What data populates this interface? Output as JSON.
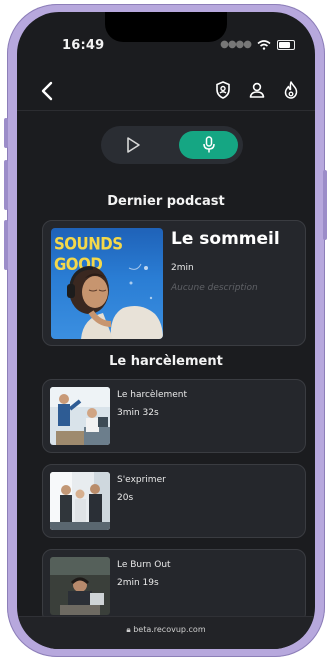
{
  "status": {
    "time": "16:49"
  },
  "sections": {
    "latest_title": "Dernier podcast",
    "category_title": "Le harcèlement"
  },
  "featured": {
    "cover_text": "SOUNDS GOOD",
    "title": "Le sommeil",
    "duration": "2min",
    "description": "Aucune description"
  },
  "episodes": [
    {
      "title": "Le harcèlement",
      "duration": "3min 32s"
    },
    {
      "title": "S'exprimer",
      "duration": "20s"
    },
    {
      "title": "Le Burn Out",
      "duration": "2min 19s"
    }
  ],
  "browser": {
    "url": "beta.recovup.com"
  },
  "colors": {
    "background": "#1b1c1f",
    "card": "#25272c",
    "accent": "#15a683"
  }
}
